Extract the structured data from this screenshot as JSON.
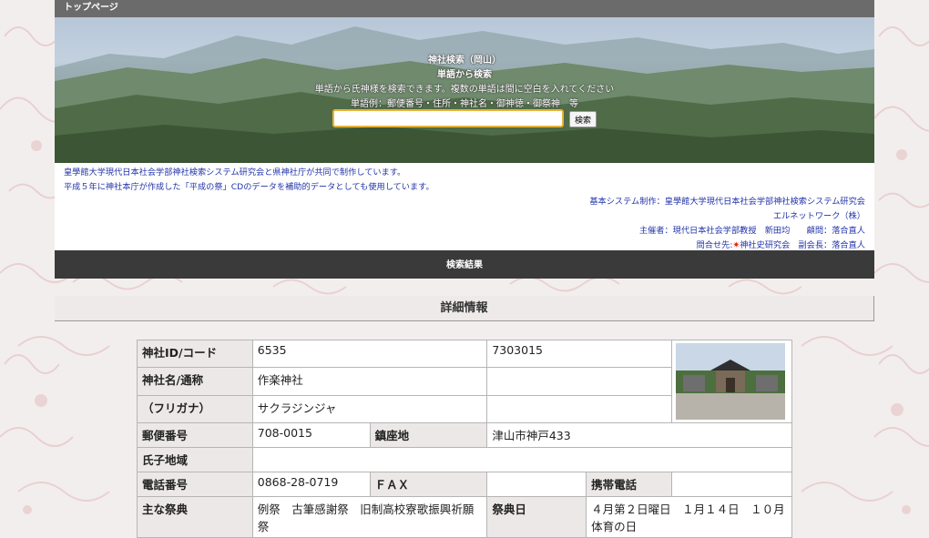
{
  "topbar": {
    "title": "トップページ"
  },
  "hero": {
    "title": "神社検索（岡山）",
    "subtitle": "単語から検索",
    "description": "単語から氏神様を検索できます。複数の単語は間に空白を入れてください",
    "example": "単語例：郵便番号・住所・神社名・御神徳・御祭神　等",
    "search_value": "",
    "search_button": "検索"
  },
  "info": {
    "line1": "皇學館大学現代日本社会学部神社検索システム研究会と県神社庁が共同で制作しています。",
    "line2": "平成５年に神社本庁が作成した「平成の祭」CDのデータを補助的データとしても使用しています。",
    "line3": "基本システム制作：皇學館大学現代日本社会学部神社検索システム研究会",
    "line4": "エルネットワーク（株）",
    "line5": "主催者：現代日本社会学部教授　新田均　　顧問：落合直人",
    "line6_prefix": "問合せ先:",
    "line6_link": "神社史研究会",
    "line6_suffix": "　副会長：落合直人"
  },
  "results_bar": "検索結果",
  "detail_title": "詳細情報",
  "details": {
    "id_label": "神社ID/コード",
    "id_value": "6535",
    "code_value": "7303015",
    "name_label": "神社名/通称",
    "name_value": "作楽神社",
    "kana_label": "（フリガナ）",
    "kana_value": "サクラジンジャ",
    "zip_label": "郵便番号",
    "zip_value": "708-0015",
    "address_label": "鎮座地",
    "address_value": "津山市神戸433",
    "ujiko_label": "氏子地域",
    "ujiko_value": "",
    "tel_label": "電話番号",
    "tel_value": "0868-28-0719",
    "fax_label": "ＦＡＸ",
    "fax_value": "",
    "mobile_label": "携帯電話",
    "mobile_value": "",
    "festival_label": "主な祭典",
    "festival_value": "例祭　古筆感謝祭　旧制高校寮歌振興祈願祭",
    "festival_date_label": "祭典日",
    "festival_date_value": "４月第２日曜日　１月１４日　１０月体育の日"
  }
}
